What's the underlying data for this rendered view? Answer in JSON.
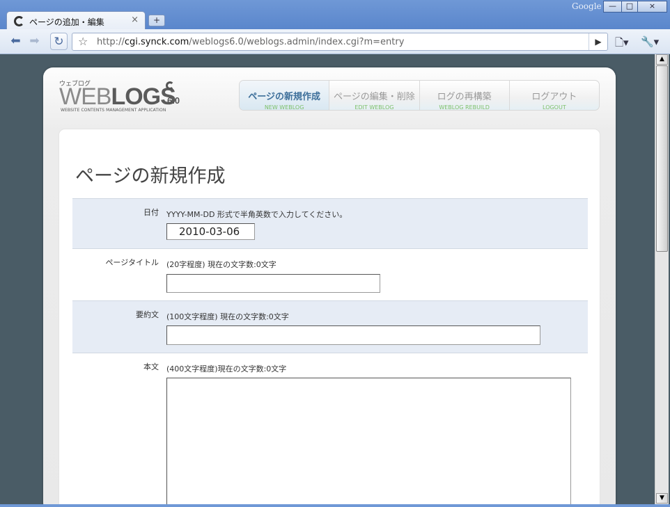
{
  "browser": {
    "tab_title": "ページの追加・編集",
    "tab_close": "×",
    "new_tab": "+",
    "brand": "Google",
    "window_buttons": [
      "—",
      "□",
      "×"
    ],
    "url_prefix": "http://",
    "url_host": "cgi.synck.com",
    "url_path": "/weblogs6.0/weblogs.admin/index.cgi?m=entry",
    "go_icon": "▶",
    "page_icon": "🗋▾",
    "wrench_icon": "🔧▾"
  },
  "logo": {
    "kana": "ウェブログ",
    "word_part1": "WEB",
    "word_part2": "LOGS",
    "version": "6.0",
    "tagline": "WEBSITE CONTENTS MANAGEMENT APPLICATION"
  },
  "nav": [
    {
      "jp": "ページの新規作成",
      "en": "NEW WEBLOG"
    },
    {
      "jp": "ページの編集・削除",
      "en": "EDIT WEBLOG"
    },
    {
      "jp": "ログの再構築",
      "en": "WEBLOG REBUILD"
    },
    {
      "jp": "ログアウト",
      "en": "LOGOUT"
    }
  ],
  "page": {
    "title": "ページの新規作成"
  },
  "form": {
    "date": {
      "label": "日付",
      "note": "YYYY-MM-DD 形式で半角英数で入力してください。",
      "value": "2010-03-06"
    },
    "title": {
      "label": "ページタイトル",
      "note": "(20字程度) 現在の文字数:0文字",
      "value": ""
    },
    "summary": {
      "label": "要約文",
      "note": "(100文字程度) 現在の文字数:0文字",
      "value": ""
    },
    "body": {
      "label": "本文",
      "note": "(400文字程度)現在の文字数:0文字",
      "value": ""
    }
  }
}
